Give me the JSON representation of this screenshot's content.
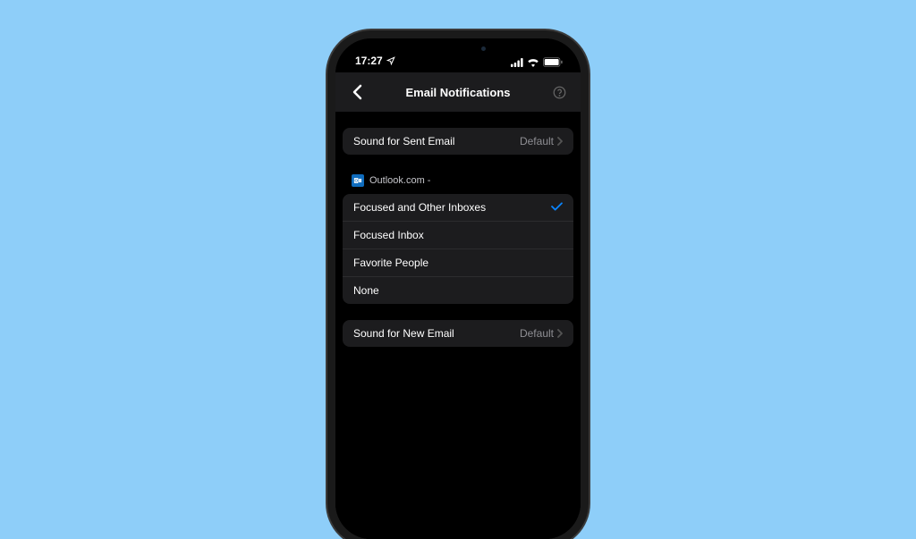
{
  "status": {
    "time": "17:27"
  },
  "nav": {
    "title": "Email Notifications"
  },
  "sound_sent": {
    "label": "Sound for Sent Email",
    "value": "Default"
  },
  "account_header": {
    "provider": "Outlook.com -"
  },
  "options": [
    {
      "label": "Focused and Other Inboxes",
      "selected": true
    },
    {
      "label": "Focused Inbox",
      "selected": false
    },
    {
      "label": "Favorite People",
      "selected": false
    },
    {
      "label": "None",
      "selected": false
    }
  ],
  "sound_new": {
    "label": "Sound for New Email",
    "value": "Default"
  }
}
